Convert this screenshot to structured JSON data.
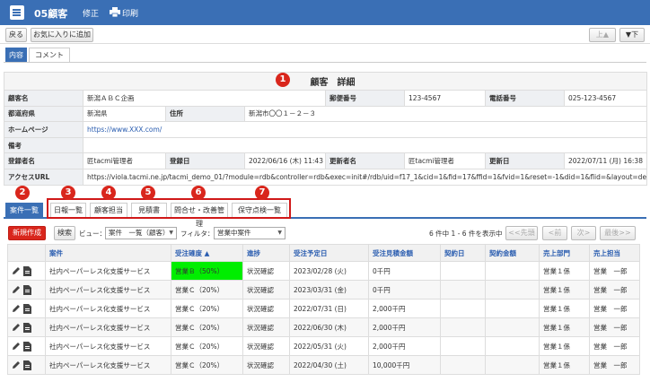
{
  "header": {
    "title": "05顧客",
    "edit": "修正",
    "print": "印刷"
  },
  "toolbar": {
    "back": "戻る",
    "favorite": "お気に入りに追加",
    "up": "上▲",
    "down": "▼下"
  },
  "tabs": {
    "content": "内容",
    "comment": "コメント"
  },
  "markers": [
    "1",
    "2",
    "3",
    "4",
    "5",
    "6",
    "7"
  ],
  "detail": {
    "title": "顧客　詳細",
    "name_label": "顧客名",
    "name": "新潟ＡＢＣ企画",
    "zip_label": "郵便番号",
    "zip": "123-4567",
    "tel_label": "電話番号",
    "tel": "025-123-4567",
    "pref_label": "都道府県",
    "pref": "新潟県",
    "addr_label": "住所",
    "addr": "新潟市〇〇１－２－３",
    "hp_label": "ホームページ",
    "hp": "https://www.XXX.com/",
    "note_label": "備考",
    "creator_label": "登録者名",
    "creator": "匠tacmi管理者",
    "created_label": "登録日",
    "created": "2022/06/16 (木) 11:43",
    "updater_label": "更新者名",
    "updater": "匠tacmi管理者",
    "updated_label": "更新日",
    "updated": "2022/07/11 (月) 16:38",
    "url_label": "アクセスURL",
    "url": "https://viola.tacmi.ne.jp/tacmi_demo_01/?module=rdb&controller=rdb&exec=init#/rdb/uid=f17_1&cid=1&fid=17&ffid=1&fvid=1&reset=-1&did=1&flid=&layout=detail&type="
  },
  "subtabs": [
    "案件一覧",
    "日報一覧",
    "顧客担当",
    "見積書",
    "問合せ・改善管理",
    "保守点検一覧"
  ],
  "listbar": {
    "new": "新規作成",
    "search": "検索",
    "view_label": "ビュー：",
    "view": "案件　一覧（顧客）",
    "filter_label": "フィルタ：",
    "filter": "営業中案件",
    "count": "6 件中 1 - 6 件を表示中",
    "first": "<<先頭",
    "prev": "<前",
    "next": "次>",
    "last": "最後>>"
  },
  "grid": {
    "headers": [
      "案件",
      "受注確度 ▲",
      "進捗",
      "受注予定日",
      "受注見積金額",
      "契約日",
      "契約金額",
      "売上部門",
      "売上担当"
    ],
    "rows": [
      [
        "社内ペーパーレス化支援サービス",
        "営業Ｂ（50%）",
        "状況確認",
        "2023/02/28 (火)",
        "0千円",
        "",
        "",
        "営業１係",
        "営業　一郎"
      ],
      [
        "社内ペーパーレス化支援サービス",
        "営業Ｃ（20%）",
        "状況確認",
        "2023/03/31 (金)",
        "0千円",
        "",
        "",
        "営業１係",
        "営業　一郎"
      ],
      [
        "社内ペーパーレス化支援サービス",
        "営業Ｃ（20%）",
        "状況確認",
        "2022/07/31 (日)",
        "2,000千円",
        "",
        "",
        "営業１係",
        "営業　一郎"
      ],
      [
        "社内ペーパーレス化支援サービス",
        "営業Ｃ（20%）",
        "状況確認",
        "2022/06/30 (木)",
        "2,000千円",
        "",
        "",
        "営業１係",
        "営業　一郎"
      ],
      [
        "社内ペーパーレス化支援サービス",
        "営業Ｃ（20%）",
        "状況確認",
        "2022/05/31 (火)",
        "2,000千円",
        "",
        "",
        "営業１係",
        "営業　一郎"
      ],
      [
        "社内ペーパーレス化支援サービス",
        "営業Ｃ（20%）",
        "状況確認",
        "2022/04/30 (土)",
        "10,000千円",
        "",
        "",
        "営業１係",
        "営業　一郎"
      ]
    ],
    "highlight_color": "#00ee00"
  }
}
